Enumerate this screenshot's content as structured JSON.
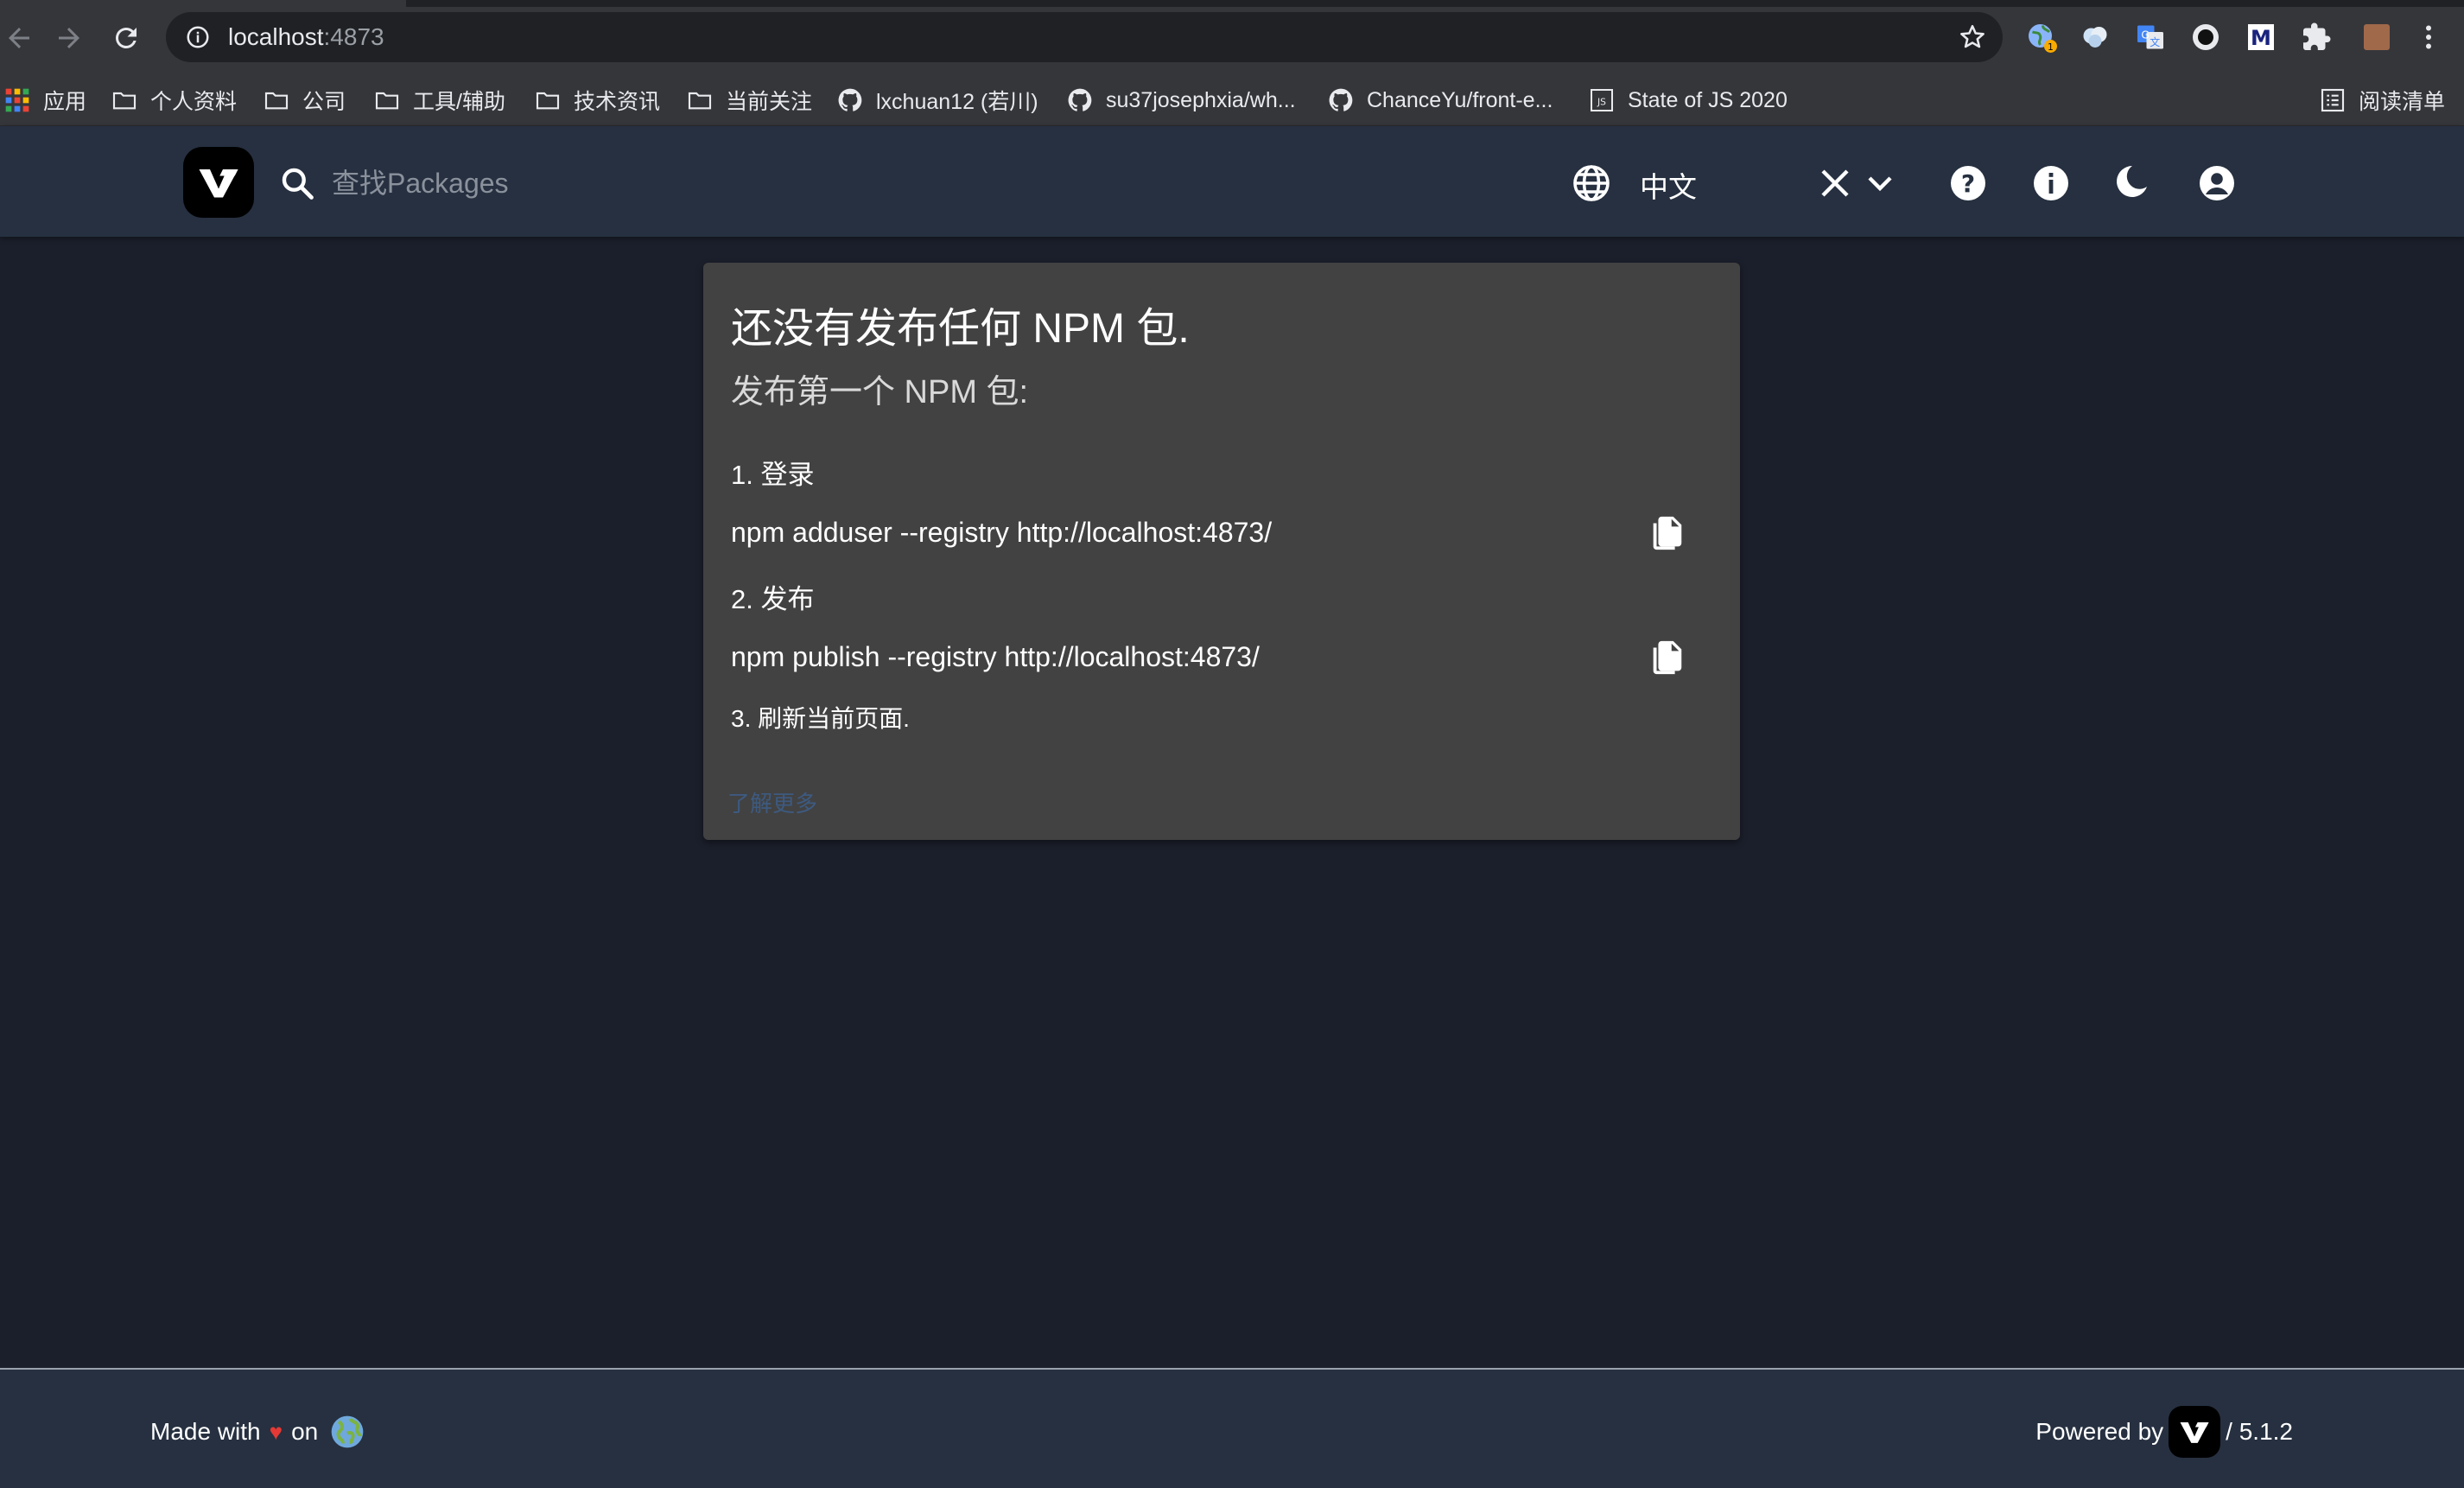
{
  "browser": {
    "url_host": "localhost",
    "url_port": ":4873",
    "bookmarks": [
      {
        "label": "应用",
        "icon": "apps-grid-icon"
      },
      {
        "label": "个人资料",
        "icon": "folder-icon"
      },
      {
        "label": "公司",
        "icon": "folder-icon"
      },
      {
        "label": "工具/辅助",
        "icon": "folder-icon"
      },
      {
        "label": "技术资讯",
        "icon": "folder-icon"
      },
      {
        "label": "当前关注",
        "icon": "folder-icon"
      },
      {
        "label": "lxchuan12 (若川)",
        "icon": "github-icon"
      },
      {
        "label": "su37josephxia/wh...",
        "icon": "github-icon"
      },
      {
        "label": "ChanceYu/front-e...",
        "icon": "github-icon"
      },
      {
        "label": "State of JS 2020",
        "icon": "js-icon"
      }
    ],
    "reading_list": "阅读清单",
    "extension_badge": "1"
  },
  "header": {
    "search_placeholder": "查找Packages",
    "language": "中文"
  },
  "card": {
    "title": "还没有发布任何 NPM 包.",
    "subtitle": "发布第一个 NPM 包:",
    "step1_title": "1. 登录",
    "step1_cmd": "npm adduser --registry http://localhost:4873/",
    "step2_title": "2. 发布",
    "step2_cmd": "npm publish --registry http://localhost:4873/",
    "step3_title": "3. 刷新当前页面.",
    "learn_more": "了解更多"
  },
  "footer": {
    "made_with": "Made with",
    "heart": "♥",
    "on": "on",
    "powered_by": "Powered by",
    "version": "/ 5.1.2"
  },
  "colors": {
    "page_bg": "#1b1f2b",
    "header_bg": "#263040",
    "card_bg": "#424242",
    "heart": "#e53935"
  }
}
